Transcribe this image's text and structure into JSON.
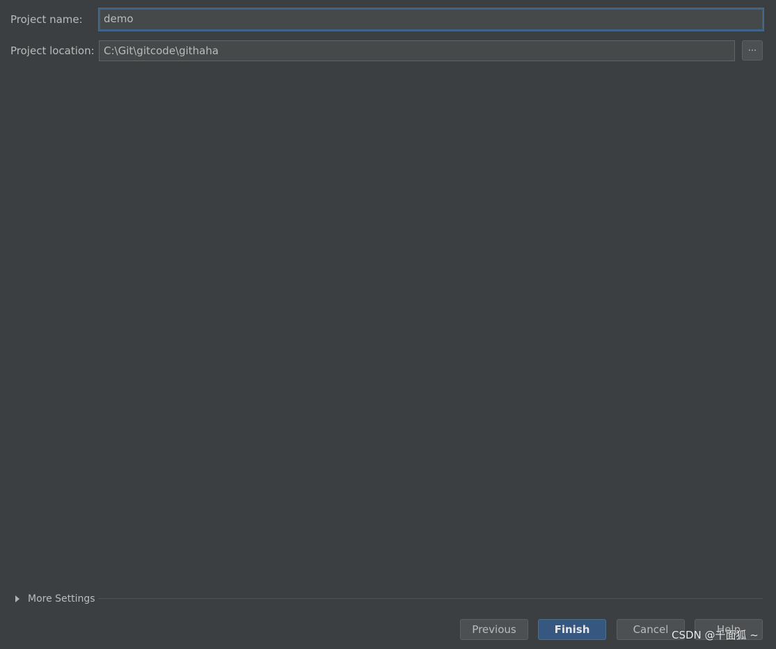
{
  "form": {
    "project_name_label": "Project name:",
    "project_name_value": "demo",
    "project_location_label": "Project location:",
    "project_location_value": "C:\\Git\\gitcode\\githaha",
    "browse_label": "..."
  },
  "more_settings": {
    "label": "More Settings",
    "expanded": false,
    "icon": "triangle-right-icon"
  },
  "buttons": {
    "previous": "Previous",
    "finish": "Finish",
    "cancel": "Cancel",
    "help": "Help"
  },
  "watermark": "CSDN @千面狐 ~",
  "colors": {
    "background": "#3c3f41",
    "field_background": "#45494a",
    "focus_border": "#3d6185",
    "primary_button": "#365880",
    "text": "#bbbbbb"
  }
}
